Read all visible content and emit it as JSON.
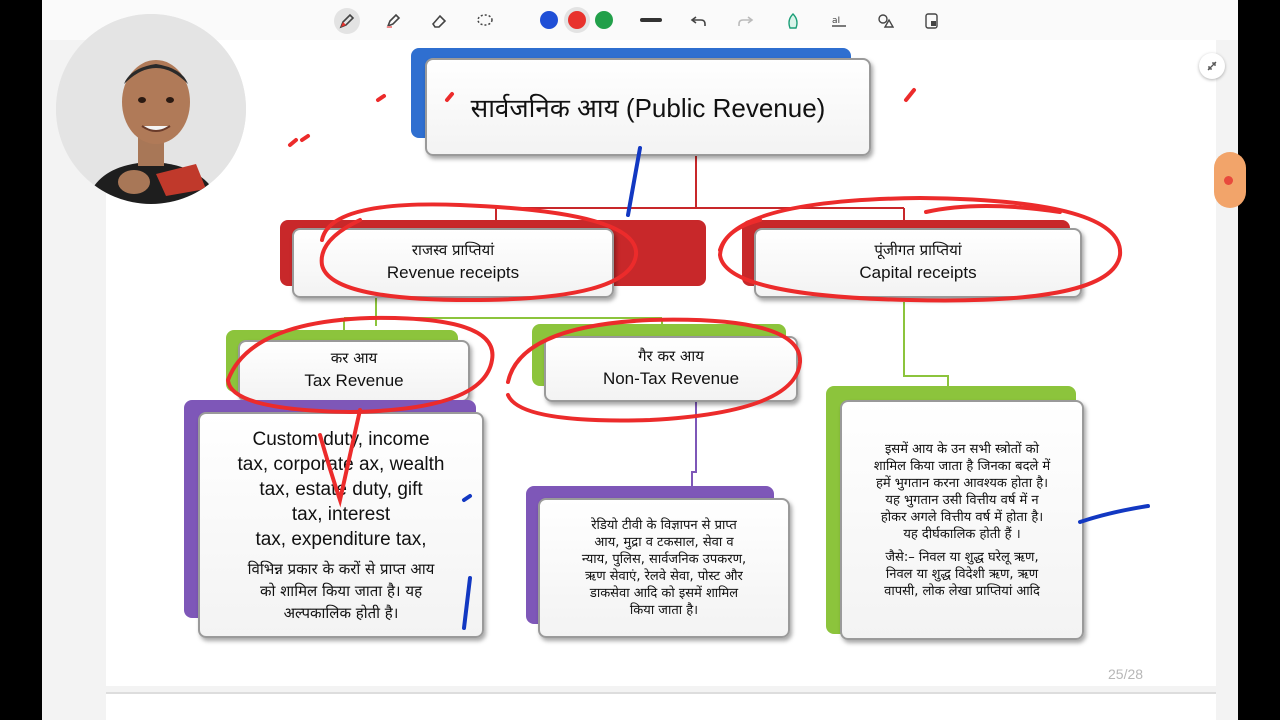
{
  "toolbar": {
    "tools": [
      "pen-icon",
      "highlighter-icon",
      "eraser-icon",
      "lasso-icon"
    ],
    "colors": [
      "#1f4fd6",
      "#e8322d",
      "#22a04a"
    ],
    "selected_color": "#e8322d",
    "actions": [
      "undo-icon",
      "redo-icon",
      "shape-pen-icon",
      "text-recognize-icon",
      "shapes-icon",
      "insert-icon"
    ]
  },
  "slide": {
    "title": "सार्वजनिक आय (Public Revenue)",
    "revenue": {
      "hi": "राजस्व प्राप्तियां",
      "en": "Revenue receipts"
    },
    "capital": {
      "hi": "पूंजीगत प्राप्तियां",
      "en": "Capital receipts"
    },
    "tax": {
      "hi": "कर आय",
      "en": "Tax Revenue"
    },
    "nontax": {
      "hi": "गैर कर आय",
      "en": "Non-Tax Revenue"
    },
    "tax_desc": {
      "en": [
        "Custom duty, income",
        "tax, corporate ax, wealth",
        "tax, estate duty, gift",
        "tax, interest",
        "tax,  expenditure tax,"
      ],
      "hi": [
        "विभिन्न प्रकार के करों से प्राप्त आय",
        "को शामिल किया जाता है। यह",
        "अल्पकालिक होती है।"
      ]
    },
    "nontax_desc": [
      "रेडियो टीवी के विज्ञापन से प्राप्त",
      "आय, मुद्रा व टकसाल, सेवा व",
      "न्याय, पुलिस, सार्वजनिक उपकरण,",
      "ऋण सेवाएं, रेलवे सेवा, पोस्ट और",
      "डाकसेवा आदि को इसमें शामिल",
      "किया जाता है।"
    ],
    "capital_desc": [
      "इसमें आय के उन सभी स्त्रोतों को",
      "शामिल किया जाता है जिनका बदले में",
      "हमें भुगतान करना आवश्यक होता है।",
      "यह भुगतान उसी वित्तीय वर्ष में न",
      "होकर अगले वित्तीय वर्ष में होता है।",
      "यह दीर्घकालिक होती हैं ।"
    ],
    "capital_examples": [
      "जैसे:– निवल या शुद्ध घरेलू ऋण,",
      "निवल या शुद्ध विदेशी ऋण, ऋण",
      "वापसी, लोक लेखा प्राप्तियां आदि"
    ]
  },
  "page_indicator": "25/28",
  "colors": {
    "title_accent": "#2f6fd0",
    "revenue_accent": "#c8282a",
    "green_accent": "#8cc43c",
    "purple_accent": "#7e57b8",
    "annotation_red": "#ec2b2b",
    "annotation_blue": "#1238c2"
  }
}
